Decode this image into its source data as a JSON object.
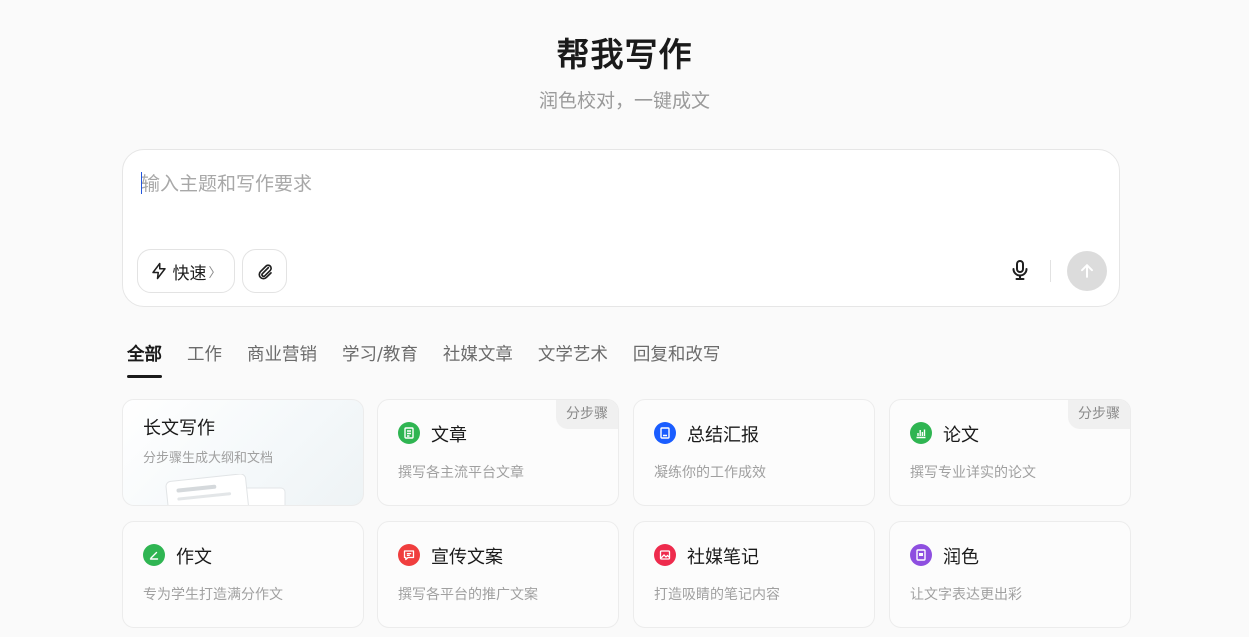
{
  "header": {
    "title": "帮我写作",
    "subtitle": "润色校对，一键成文"
  },
  "composer": {
    "placeholder": "输入主题和写作要求",
    "value": "",
    "quick_label": "快速",
    "quick_chevron": "〉",
    "attach_icon": "paperclip-icon",
    "mic_icon": "microphone-icon",
    "send_icon": "arrow-up-icon"
  },
  "tabs": [
    {
      "label": "全部",
      "active": true
    },
    {
      "label": "工作",
      "active": false
    },
    {
      "label": "商业营销",
      "active": false
    },
    {
      "label": "学习/教育",
      "active": false
    },
    {
      "label": "社媒文章",
      "active": false
    },
    {
      "label": "文学艺术",
      "active": false
    },
    {
      "label": "回复和改写",
      "active": false
    }
  ],
  "cards": [
    {
      "title": "长文写作",
      "desc": "分步骤生成大纲和文档",
      "icon": "document-illustration",
      "badge": ""
    },
    {
      "title": "文章",
      "desc": "撰写各主流平台文章",
      "icon": "article-icon",
      "color": "#2fb552",
      "badge": "分步骤"
    },
    {
      "title": "总结汇报",
      "desc": "凝练你的工作成效",
      "icon": "report-icon",
      "color": "#1a5dff",
      "badge": ""
    },
    {
      "title": "论文",
      "desc": "撰写专业详实的论文",
      "icon": "chart-icon",
      "color": "#2fb552",
      "badge": "分步骤"
    },
    {
      "title": "作文",
      "desc": "专为学生打造满分作文",
      "icon": "pen-icon",
      "color": "#2fb552",
      "badge": ""
    },
    {
      "title": "宣传文案",
      "desc": "撰写各平台的推广文案",
      "icon": "message-icon",
      "color": "#f03e3e",
      "badge": ""
    },
    {
      "title": "社媒笔记",
      "desc": "打造吸睛的笔记内容",
      "icon": "image-icon",
      "color": "#ee2b4d",
      "badge": ""
    },
    {
      "title": "润色",
      "desc": "让文字表达更出彩",
      "icon": "polish-icon",
      "color": "#8e4fe0",
      "badge": ""
    }
  ]
}
